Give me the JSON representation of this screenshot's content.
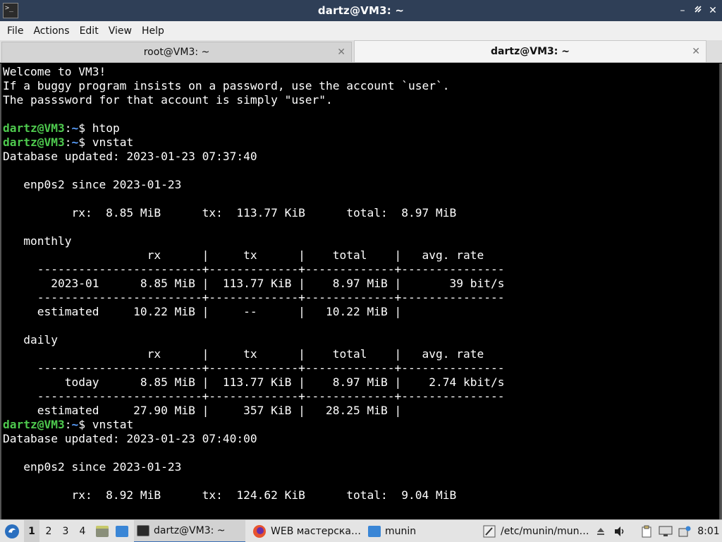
{
  "window": {
    "title": "dartz@VM3: ~",
    "controls": [
      "minimize-icon",
      "maximize-icon",
      "close-icon"
    ]
  },
  "menu": [
    "File",
    "Actions",
    "Edit",
    "View",
    "Help"
  ],
  "tabs": [
    {
      "label": "root@VM3: ~",
      "active": false
    },
    {
      "label": "dartz@VM3: ~",
      "active": true
    }
  ],
  "terminal": {
    "lines": [
      {
        "text": "Welcome to VM3!"
      },
      {
        "text": "If a buggy program insists on a password, use the account `user`."
      },
      {
        "text": "The passsword for that account is simply \"user\"."
      },
      {
        "text": ""
      },
      {
        "prompt": {
          "user": "dartz@VM3",
          "sep": ":",
          "path": "~",
          "sym": "$ "
        },
        "text": "htop"
      },
      {
        "prompt": {
          "user": "dartz@VM3",
          "sep": ":",
          "path": "~",
          "sym": "$ "
        },
        "text": "vnstat"
      },
      {
        "text": "Database updated: 2023-01-23 07:37:40"
      },
      {
        "text": ""
      },
      {
        "text": "   enp0s2 since 2023-01-23"
      },
      {
        "text": ""
      },
      {
        "text": "          rx:  8.85 MiB      tx:  113.77 KiB      total:  8.97 MiB"
      },
      {
        "text": ""
      },
      {
        "text": "   monthly"
      },
      {
        "text": "                     rx      |     tx      |    total    |   avg. rate"
      },
      {
        "text": "     ------------------------+-------------+-------------+---------------"
      },
      {
        "text": "       2023-01      8.85 MiB |  113.77 KiB |    8.97 MiB |       39 bit/s"
      },
      {
        "text": "     ------------------------+-------------+-------------+---------------"
      },
      {
        "text": "     estimated     10.22 MiB |     --      |   10.22 MiB |"
      },
      {
        "text": ""
      },
      {
        "text": "   daily"
      },
      {
        "text": "                     rx      |     tx      |    total    |   avg. rate"
      },
      {
        "text": "     ------------------------+-------------+-------------+---------------"
      },
      {
        "text": "         today      8.85 MiB |  113.77 KiB |    8.97 MiB |    2.74 kbit/s"
      },
      {
        "text": "     ------------------------+-------------+-------------+---------------"
      },
      {
        "text": "     estimated     27.90 MiB |     357 KiB |   28.25 MiB |"
      },
      {
        "prompt": {
          "user": "dartz@VM3",
          "sep": ":",
          "path": "~",
          "sym": "$ "
        },
        "text": "vnstat"
      },
      {
        "text": "Database updated: 2023-01-23 07:40:00"
      },
      {
        "text": ""
      },
      {
        "text": "   enp0s2 since 2023-01-23"
      },
      {
        "text": ""
      },
      {
        "text": "          rx:  8.92 MiB      tx:  124.62 KiB      total:  9.04 MiB"
      }
    ]
  },
  "taskbar": {
    "workspaces": [
      "1",
      "2",
      "3",
      "4"
    ],
    "active_workspace": "1",
    "tasks": [
      {
        "label": "dartz@VM3: ~",
        "icon": "terminal-icon"
      },
      {
        "label": "WEB мастерска…",
        "icon": "firefox-icon"
      },
      {
        "label": "munin",
        "icon": "folder-icon"
      },
      {
        "label": "/etc/munin/mun…",
        "icon": "text-editor-icon"
      }
    ],
    "clock": "8:01"
  },
  "colors": {
    "titlebar": "#2f3f57",
    "prompt_user": "#4ec94e",
    "prompt_path": "#5aa0ff",
    "terminal_bg": "#000000",
    "task_active_underline": "#3b6fb6"
  }
}
